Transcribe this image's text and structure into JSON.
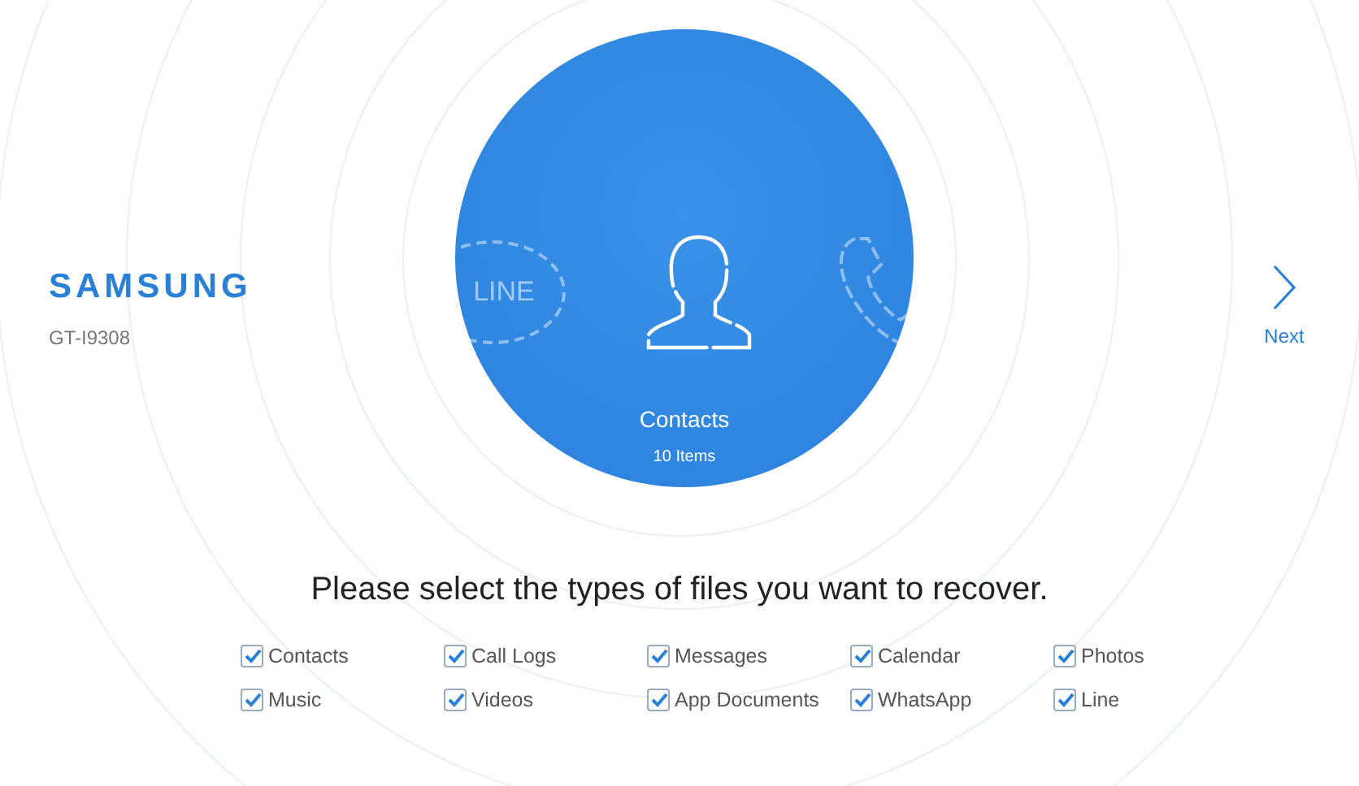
{
  "device": {
    "brand": "SAMSUNG",
    "model": "GT-I9308"
  },
  "carousel": {
    "previous_label": "LINE",
    "category": "Contacts",
    "count": "10 Items"
  },
  "next": {
    "label": "Next"
  },
  "prompt": "Please select the types of files you want to recover.",
  "file_types": [
    {
      "label": "Contacts",
      "checked": true
    },
    {
      "label": "Call Logs",
      "checked": true
    },
    {
      "label": "Messages",
      "checked": true
    },
    {
      "label": "Calendar",
      "checked": true
    },
    {
      "label": "Photos",
      "checked": true
    },
    {
      "label": "Music",
      "checked": true
    },
    {
      "label": "Videos",
      "checked": true
    },
    {
      "label": "App Documents",
      "checked": true
    },
    {
      "label": "WhatsApp",
      "checked": true
    },
    {
      "label": "Line",
      "checked": true
    }
  ]
}
